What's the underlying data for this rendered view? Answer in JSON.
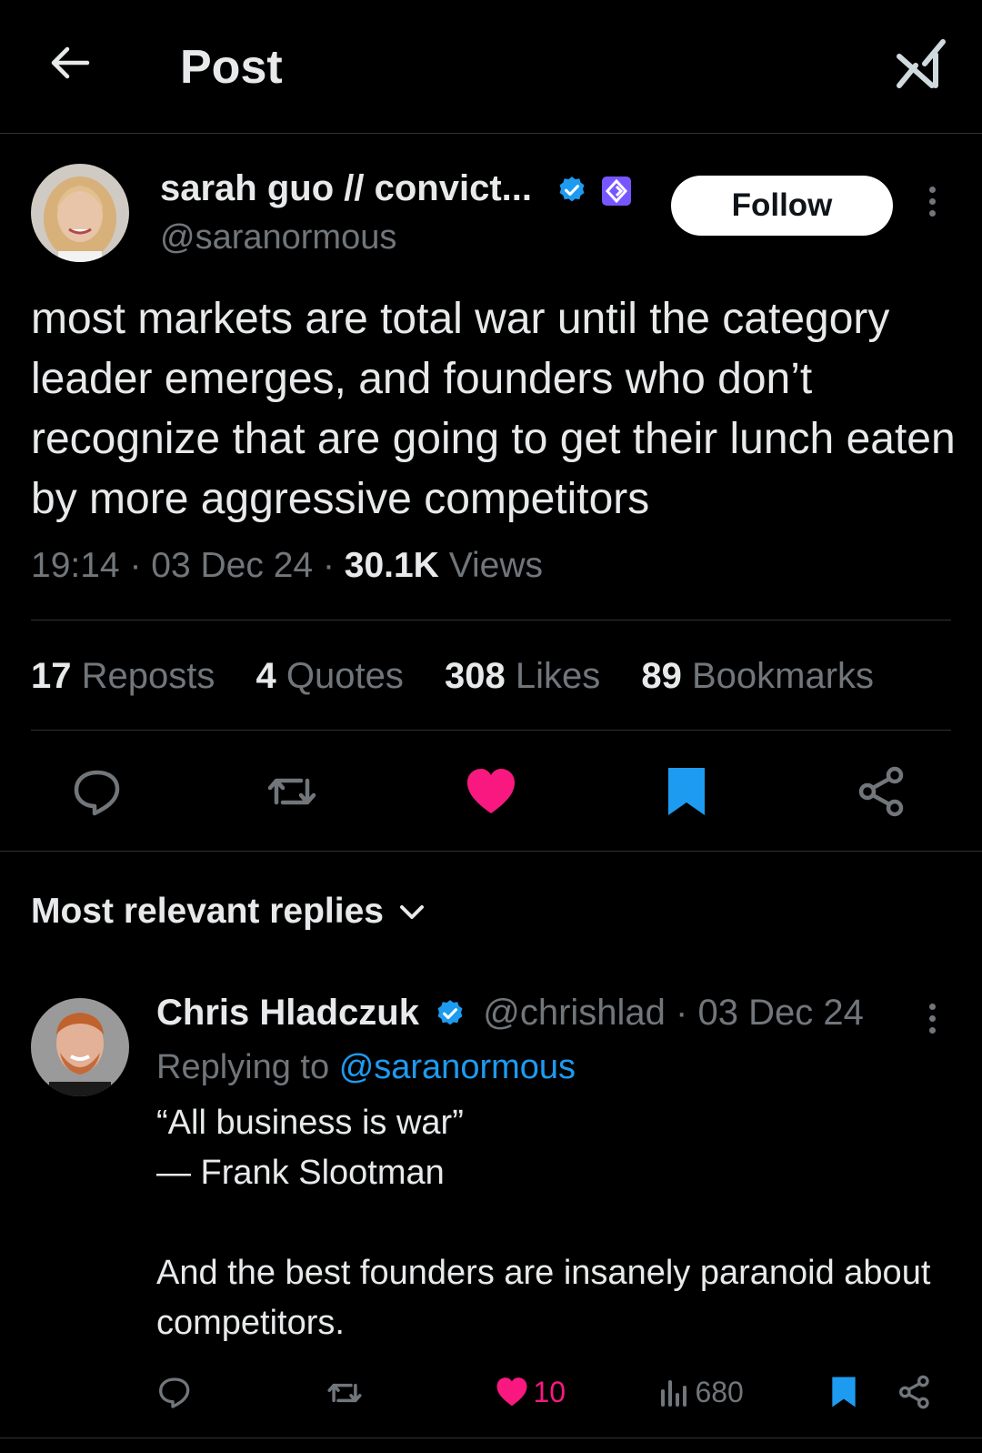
{
  "header": {
    "title": "Post"
  },
  "post": {
    "author_name": "sarah guo // convict...",
    "author_handle": "@saranormous",
    "follow_label": "Follow",
    "text": "most markets are total war until the category leader emerges, and founders who don’t recognize that are going to get their lunch eaten by more aggressive competitors",
    "time": "19:14",
    "date": "03 Dec 24",
    "views_count": "30.1K",
    "views_label": "Views",
    "sep": "·",
    "stats": {
      "reposts_count": "17",
      "reposts_label": "Reposts",
      "quotes_count": "4",
      "quotes_label": "Quotes",
      "likes_count": "308",
      "likes_label": "Likes",
      "bookmarks_count": "89",
      "bookmarks_label": "Bookmarks"
    },
    "colors": {
      "like": "#f91880",
      "bookmark": "#1d9bf0",
      "verified": "#1d9bf0",
      "affiliate": "#7856ff"
    }
  },
  "replies_section": {
    "label": "Most relevant replies"
  },
  "reply": {
    "author_name": "Chris Hladczuk",
    "author_handle": "@chrishlad",
    "sep": "·",
    "date": "03 Dec 24",
    "replying_label": "Replying to",
    "replying_handle": "@saranormous",
    "line1": "“All business is war”",
    "line2": "— Frank Slootman",
    "line3": "And the best founders are insanely paranoid about competitors.",
    "likes": "10",
    "views": "680"
  },
  "icons": [
    "back-arrow-icon",
    "grok-icon",
    "verified-badge-icon",
    "affiliate-badge-icon",
    "more-icon",
    "reply-icon",
    "repost-icon",
    "like-icon",
    "bookmark-icon",
    "share-icon",
    "chevron-down-icon",
    "views-icon"
  ]
}
